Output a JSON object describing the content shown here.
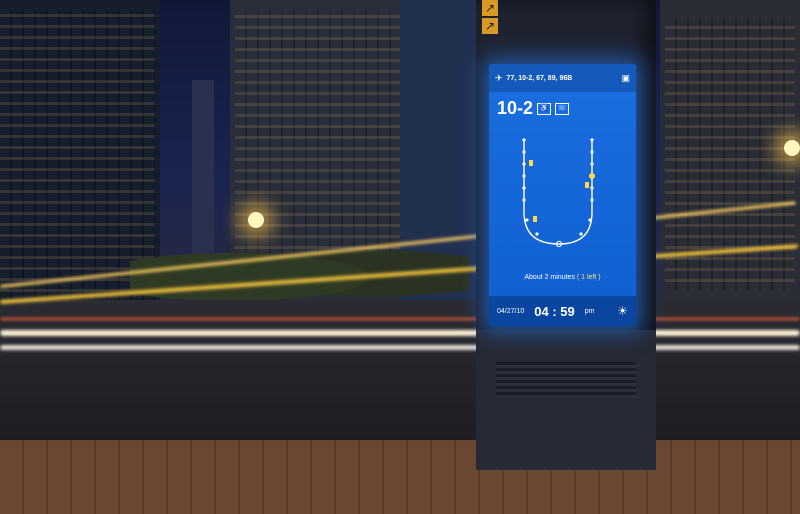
{
  "scene": {
    "description_icons": [
      "sign-arrow-up-icon",
      "sign-arrow-up-icon-2"
    ]
  },
  "kiosk": {
    "routes": "77, 10-2, 67, 89, 96B",
    "route_number": "10-2",
    "eta_prefix": "About 2 minutes",
    "eta_detail": "( 1 left )",
    "date": "04/27/10",
    "time": "04 : 59",
    "ampm": "pm"
  }
}
